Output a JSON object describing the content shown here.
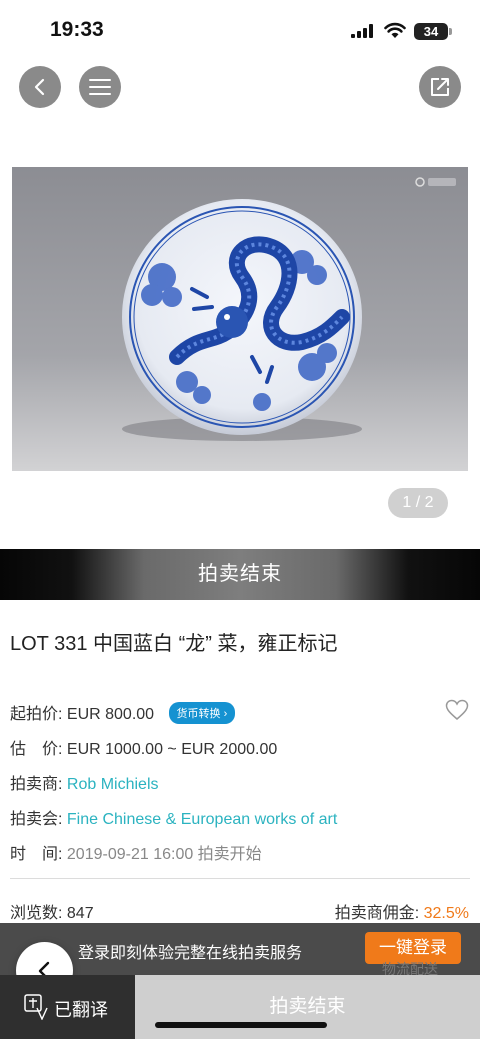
{
  "status_bar": {
    "time": "19:33",
    "battery": "34"
  },
  "gallery": {
    "counter": "1 / 2"
  },
  "banner": {
    "status": "拍卖结束"
  },
  "lot": {
    "title": "LOT 331 中国蓝白 “龙” 菜，雍正标记"
  },
  "details": {
    "start_price_label": "起拍价:",
    "start_price": "EUR 800.00",
    "currency_convert": "货币转换 ›",
    "estimate_label": "估　价:",
    "estimate": "EUR 1000.00 ~ EUR 2000.00",
    "auctioneer_label": "拍卖商:",
    "auctioneer": "Rob Michiels",
    "sale_label": "拍卖会:",
    "sale": "Fine Chinese & European works of art",
    "time_label": "时　间:",
    "time": "2019-09-21 16:00 拍卖开始"
  },
  "stats": {
    "views_label": "浏览数:",
    "views": "847",
    "commission_label": "拍卖商佣金:",
    "commission": "32.5%"
  },
  "promo": {
    "text": "登录即刻体验完整在线拍卖服务",
    "login_button": "一键登录",
    "shipping": "物流配送"
  },
  "bottom_bar": {
    "translated": "已翻译",
    "ended": "拍卖结束"
  },
  "colors": {
    "accent_link": "#2bb3c0",
    "accent_orange": "#f07a1a",
    "badge_blue": "#1592d1"
  }
}
